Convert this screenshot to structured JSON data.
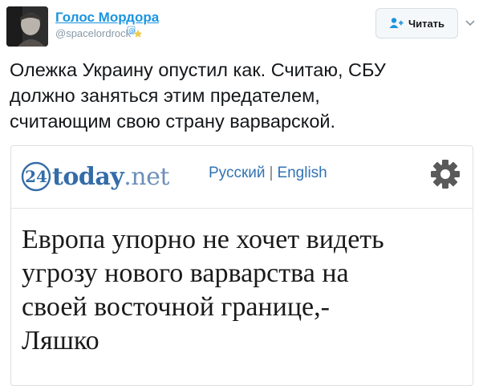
{
  "tweet": {
    "author": {
      "display_name": "Голос Мордора",
      "handle": "@spacelordrock",
      "avatar_icon": "user-avatar-photo"
    },
    "follow_button": {
      "label": "Читать",
      "icon": "follow-user-icon"
    },
    "menu_icon": "chevron-down-icon",
    "text_lines": [
      "Олежка Украину опустил как. Считаю, СБУ",
      "должно заняться этим предателем,",
      "считающим свою страну варварской."
    ]
  },
  "card": {
    "site": {
      "logo_number": "24",
      "logo_name": "today",
      "logo_tld": ".net"
    },
    "languages": [
      "Русский",
      "English"
    ],
    "language_separator": "|",
    "settings_icon": "gear-icon",
    "headline_lines": [
      "Европа упорно не хочет видеть",
      "угрозу нового варварства на",
      "своей восточной границе,-",
      "Ляшко"
    ]
  },
  "colors": {
    "link_blue": "#1b95e0",
    "site_blue": "#336ca8",
    "text": "#14171a",
    "muted": "#8899a6"
  }
}
